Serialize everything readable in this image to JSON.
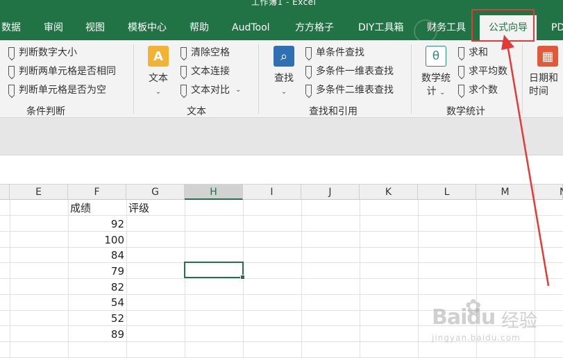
{
  "window": {
    "title": "工作簿1  -  Excel"
  },
  "tabs": [
    {
      "label": "数据"
    },
    {
      "label": "审阅"
    },
    {
      "label": "视图"
    },
    {
      "label": "模板中心"
    },
    {
      "label": "帮助"
    },
    {
      "label": "AudTool"
    },
    {
      "label": "方方格子"
    },
    {
      "label": "DIY工具箱"
    },
    {
      "label": "财务工具"
    },
    {
      "label": "公式向导"
    },
    {
      "label": "PD"
    }
  ],
  "ribbon": {
    "condition": {
      "items": [
        "判断数字大小",
        "判断两单元格是否相同",
        "判断单元格是否为空"
      ],
      "label": "条件判断"
    },
    "text": {
      "big_button": "文本",
      "items": [
        "清除空格",
        "文本连接",
        "文本对比"
      ],
      "label": "文本"
    },
    "lookup": {
      "big_button": "查找",
      "items": [
        "单条件查找",
        "多条件一维表查找",
        "多条件二维表查找"
      ],
      "label": "查找和引用"
    },
    "math": {
      "big_button_line1": "数学统",
      "big_button_line2": "计",
      "items": [
        "求和",
        "求平均数",
        "求个数"
      ],
      "label": "数学统计"
    },
    "date": {
      "big_button_line1": "日期和",
      "big_button_line2": "时间"
    }
  },
  "sheet": {
    "columns": [
      "E",
      "F",
      "G",
      "H",
      "I",
      "J",
      "K",
      "L",
      "M",
      "N"
    ],
    "selected_column": "H",
    "header_row": {
      "f": "成绩",
      "g": "评级"
    },
    "scores": [
      "92",
      "100",
      "84",
      "79",
      "82",
      "54",
      "52",
      "89"
    ]
  },
  "colors": {
    "excel_green": "#217346",
    "annotation_red": "#e53935"
  },
  "watermark": {
    "brand": "Baidu",
    "brand_cn": "经验",
    "url": "jingyan.baidu.com"
  }
}
